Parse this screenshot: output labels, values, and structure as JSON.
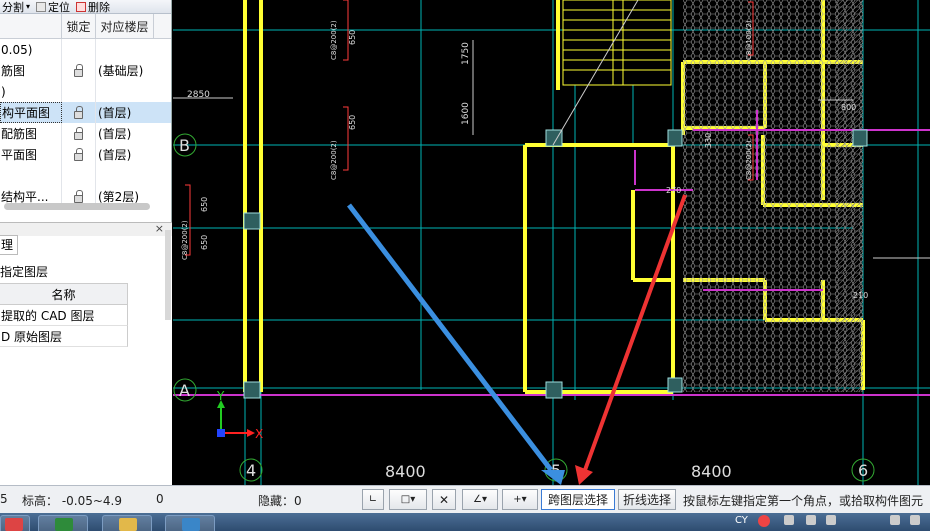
{
  "left_panel": {
    "toolbar": {
      "item1": "分割",
      "item2": "定位",
      "item3": "删除"
    },
    "columns": {
      "name": "",
      "lock": "锁定",
      "floor": "对应楼层"
    },
    "rows": [
      {
        "name": "0.05)",
        "floor": "",
        "locked": false
      },
      {
        "name": "筋图",
        "floor": "(基础层)",
        "locked": true
      },
      {
        "name": ")",
        "floor": "",
        "locked": false
      },
      {
        "name": "构平面图",
        "floor": "(首层)",
        "locked": true,
        "selected": true
      },
      {
        "name": "配筋图",
        "floor": "(首层)",
        "locked": true
      },
      {
        "name": "平面图",
        "floor": "(首层)",
        "locked": true
      },
      {
        "name": "",
        "floor": "",
        "locked": false
      },
      {
        "name": "结构平...",
        "floor": "(第2层)",
        "locked": true
      }
    ],
    "section2": {
      "tab": "理",
      "close": "×",
      "subtitle": "指定图层",
      "header": "名称",
      "items": [
        "提取的 CAD 图层",
        "D 原始图层"
      ]
    }
  },
  "cad": {
    "axis_labels": {
      "b": "B",
      "a": "A",
      "c4": "4",
      "c5": "5",
      "c6": "6"
    },
    "dims": {
      "d1": "8400",
      "d2": "8400",
      "d3": "2850",
      "d4": "1750",
      "d5": "1600",
      "d6": "650",
      "d7": "650",
      "d8": "650",
      "d9": "650",
      "d10": "800",
      "d11": "210",
      "d12": "270",
      "d13": "330"
    },
    "ucs": {
      "x": "X",
      "y": "Y"
    },
    "vtexts": {
      "t1": "C8@200(2)",
      "t2": "C8@200(2)",
      "t3": "C8@200(2)",
      "t4": "C8@100(2)",
      "t5": "C8@200(2)"
    },
    "colors": {
      "yellow": "#ffff33",
      "cyan": "#2aa9a9",
      "grid": "#00b3b3",
      "magenta": "#cc33cc",
      "red": "#ff3b3b",
      "white": "#dddddd"
    }
  },
  "status": {
    "left_value": "5",
    "elevation": "标高： -0.05~4.9",
    "zero": "0",
    "hidden": "隐藏：0",
    "cross_layer": "跨图层选择",
    "polyline": "折线选择",
    "hint": "按鼠标左键指定第一个角点，或拾取构件图元"
  },
  "taskbar": {
    "tray": "CY"
  },
  "arrows": {
    "blue": "#3b8fe0",
    "red": "#ee3333"
  }
}
